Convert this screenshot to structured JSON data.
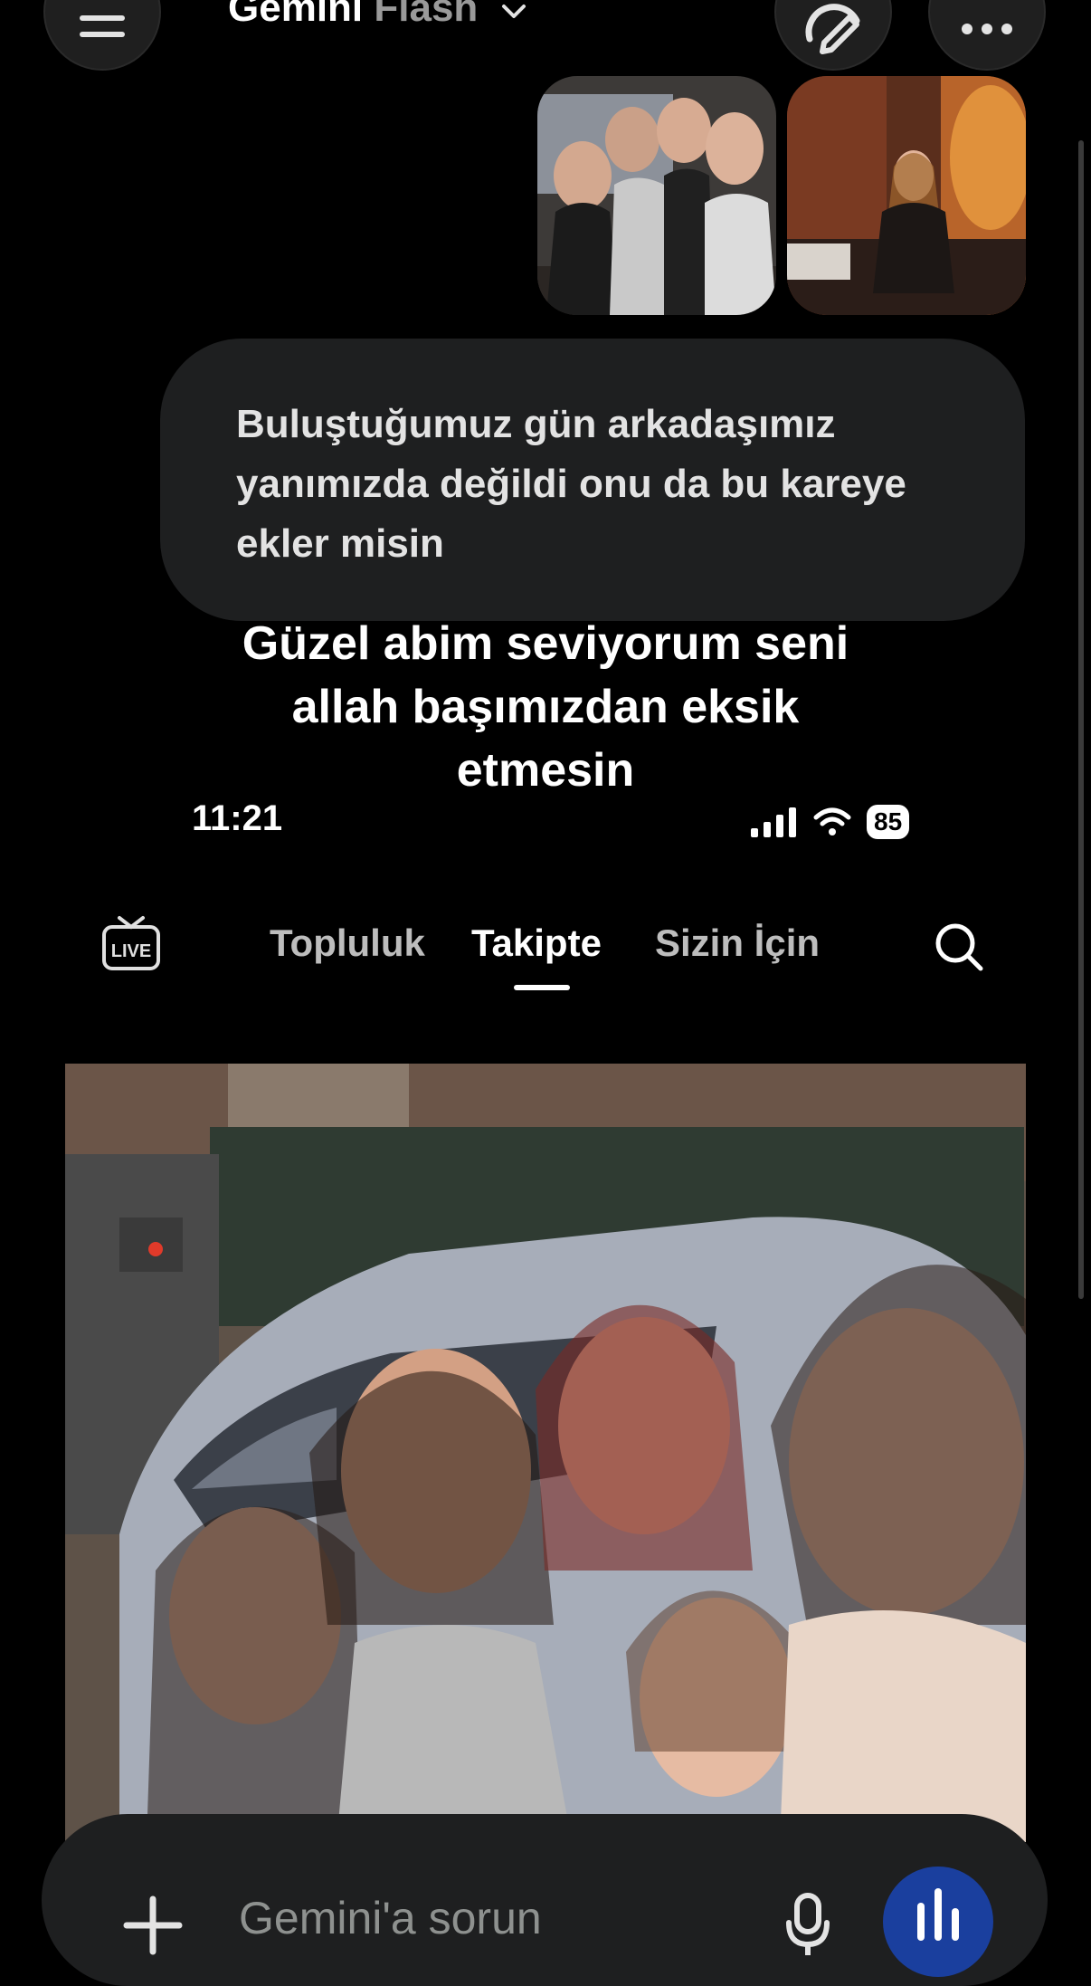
{
  "header": {
    "menu_icon": "menu-icon",
    "model_name": "Gemini",
    "model_variant": "Flash",
    "new_chat_icon": "edit-pen-icon",
    "more_icon": "more-horizontal-icon"
  },
  "conversation": {
    "user_message": "Buluştuğumuz gün arkadaşımız yanımızda değildi onu da bu kareye ekler misin"
  },
  "shared_screenshot": {
    "caption": "Güzel abim seviyorum seni allah başımızdan eksik etmesin",
    "status_time": "11:21",
    "battery": "85",
    "nav": {
      "live_label": "LIVE",
      "tabs": [
        "Topluluk",
        "Takipte",
        "Sizin İçin"
      ],
      "active_tab": "Takipte",
      "search_icon": "search-icon"
    }
  },
  "input": {
    "placeholder": "Gemini'a sorun",
    "add_icon": "plus-icon",
    "mic_icon": "microphone-icon",
    "live_icon": "voice-waveform-icon",
    "accent": "#1a3f9e"
  }
}
